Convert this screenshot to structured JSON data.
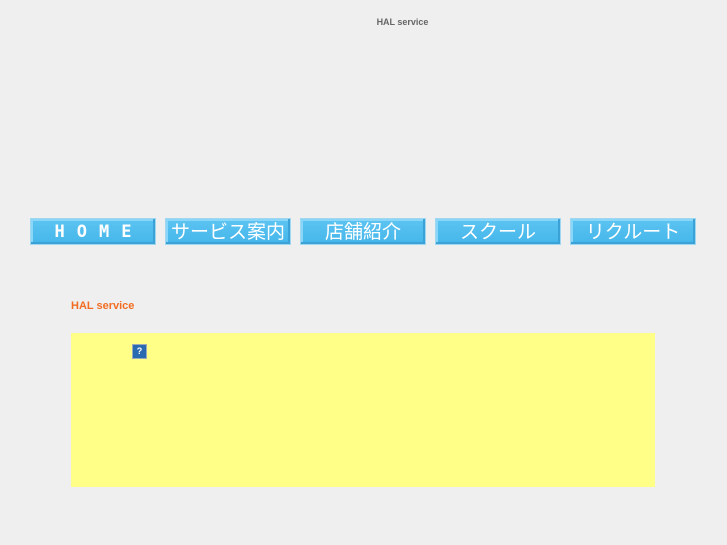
{
  "header": {
    "title": "HAL service"
  },
  "nav": [
    {
      "label": "HOME"
    },
    {
      "label": "サービス案内"
    },
    {
      "label": "店舗紹介"
    },
    {
      "label": "スクール"
    },
    {
      "label": "リクルート"
    }
  ],
  "main": {
    "title": "HAL service",
    "broken_image_glyph": "?"
  },
  "colors": {
    "nav": "#4bbbee",
    "accent": "#f26d21",
    "panel": "#ffff88",
    "background": "#efefef"
  }
}
